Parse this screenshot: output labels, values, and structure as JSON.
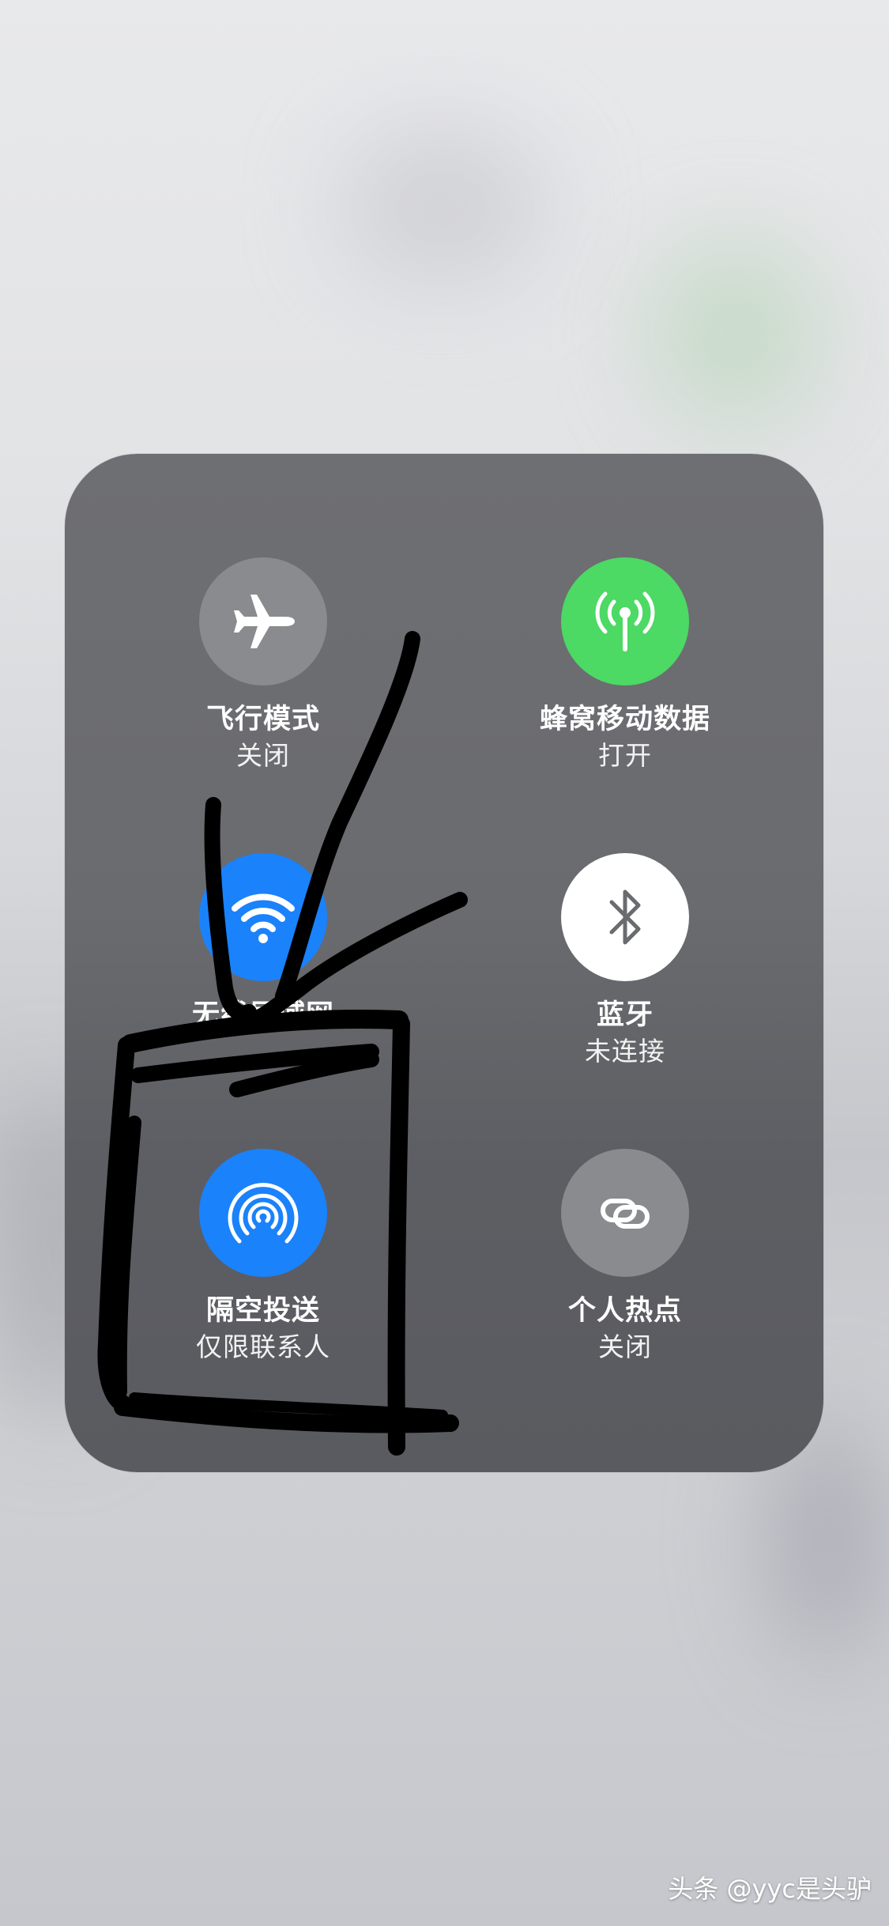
{
  "control_center": {
    "airplane": {
      "label": "飞行模式",
      "status": "关闭",
      "icon": "airplane-icon",
      "color": "#8a8b8e",
      "active": false
    },
    "cellular": {
      "label": "蜂窝移动数据",
      "status": "打开",
      "icon": "cellular-antenna-icon",
      "color": "#4cd964",
      "active": true
    },
    "wifi": {
      "label": "无线局域网",
      "status": "",
      "icon": "wifi-icon",
      "color": "#1a82fb",
      "active": true
    },
    "bluetooth": {
      "label": "蓝牙",
      "status": "未连接",
      "icon": "bluetooth-icon",
      "color": "#ffffff",
      "active": true
    },
    "airdrop": {
      "label": "隔空投送",
      "status": "仅限联系人",
      "icon": "airdrop-icon",
      "color": "#1a82fb",
      "active": true
    },
    "hotspot": {
      "label": "个人热点",
      "status": "关闭",
      "icon": "link-icon",
      "color": "#8a8b8e",
      "active": false
    }
  },
  "watermark": "头条 @yyc是头驴"
}
